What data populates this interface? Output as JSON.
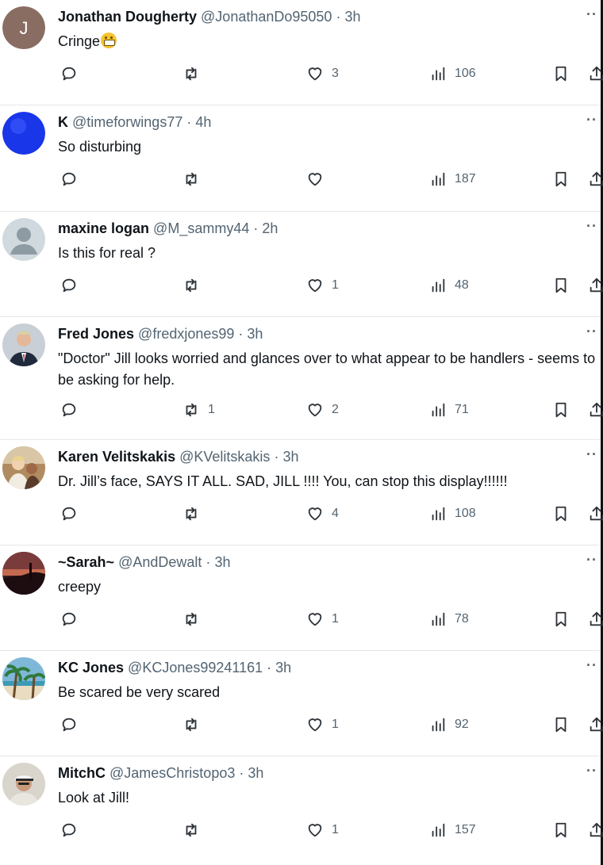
{
  "tweets": [
    {
      "name": "Jonathan Dougherty",
      "handle": "@JonathanDo95050",
      "time": "3h",
      "text": "Cringe",
      "emoji": "grimacing-face",
      "replies": "",
      "retweets": "",
      "likes": "3",
      "views": "106",
      "avatar": {
        "kind": "letter",
        "letter": "J",
        "bg": "#8a6d62"
      }
    },
    {
      "name": "K",
      "handle": "@timeforwings77",
      "time": "4h",
      "text": "So disturbing",
      "replies": "",
      "retweets": "",
      "likes": "",
      "views": "187",
      "avatar": {
        "kind": "solid",
        "bg": "#1936e8"
      }
    },
    {
      "name": "maxine logan",
      "handle": "@M_sammy44",
      "time": "2h",
      "text": "Is this for real ?",
      "replies": "",
      "retweets": "",
      "likes": "1",
      "views": "48",
      "avatar": {
        "kind": "default-person",
        "bg": "#cfd9de"
      }
    },
    {
      "name": "Fred Jones",
      "handle": "@fredxjones99",
      "time": "3h",
      "text": "\"Doctor\" Jill looks worried and glances over to what appear to be handlers - seems to be asking for help.",
      "replies": "",
      "retweets": "1",
      "likes": "2",
      "views": "71",
      "avatar": {
        "kind": "photo-portrait",
        "bg": "#c9cfd6"
      }
    },
    {
      "name": "Karen Velitskakis",
      "handle": "@KVelitskakis",
      "time": "3h",
      "text": "Dr. Jill’s face, SAYS IT ALL. SAD, JILL !!!! You, can stop this display!!!!!!",
      "replies": "",
      "retweets": "",
      "likes": "4",
      "views": "108",
      "avatar": {
        "kind": "photo-people",
        "bg": "#b08a60"
      }
    },
    {
      "name": "~Sarah~",
      "handle": "@AndDewalt",
      "time": "3h",
      "text": "creepy",
      "replies": "",
      "retweets": "",
      "likes": "1",
      "views": "78",
      "avatar": {
        "kind": "photo-sunset",
        "bg": "#3a1d1f"
      }
    },
    {
      "name": "KC Jones",
      "handle": "@KCJones99241161",
      "time": "3h",
      "text": "Be scared be very scared",
      "replies": "",
      "retweets": "",
      "likes": "1",
      "views": "92",
      "avatar": {
        "kind": "photo-beach",
        "bg": "#7fb7d8"
      }
    },
    {
      "name": "MitchC",
      "handle": "@JamesChristopo3",
      "time": "3h",
      "text": "Look at Jill!",
      "replies": "",
      "retweets": "",
      "likes": "1",
      "views": "157",
      "avatar": {
        "kind": "photo-man-cap",
        "bg": "#d9d4cc"
      }
    }
  ]
}
